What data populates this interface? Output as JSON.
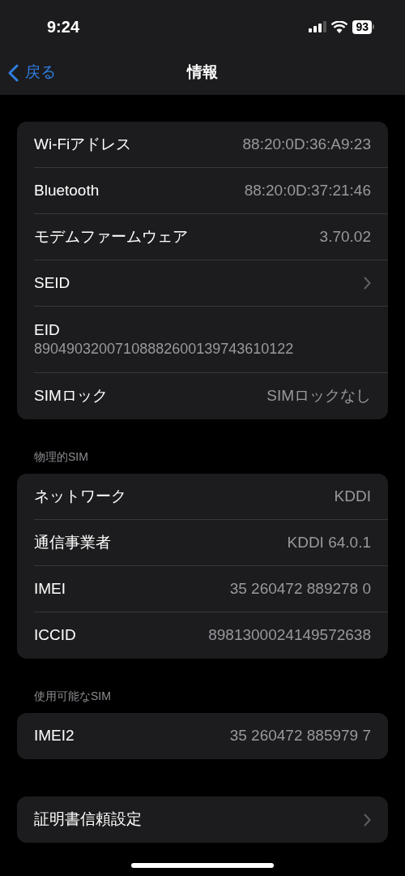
{
  "status_bar": {
    "time": "9:24",
    "battery": "93"
  },
  "nav": {
    "back": "戻る",
    "title": "情報"
  },
  "sections": [
    {
      "rows": [
        {
          "kind": "value",
          "label": "Wi-Fiアドレス",
          "value": "88:20:0D:36:A9:23"
        },
        {
          "kind": "value",
          "label": "Bluetooth",
          "value": "88:20:0D:37:21:46"
        },
        {
          "kind": "value",
          "label": "モデムファームウェア",
          "value": "3.70.02"
        },
        {
          "kind": "chevron",
          "label": "SEID"
        },
        {
          "kind": "stacked",
          "label": "EID",
          "value": "89049032007108882600139743610122"
        },
        {
          "kind": "value",
          "label": "SIMロック",
          "value": "SIMロックなし"
        }
      ]
    },
    {
      "header": "物理的SIM",
      "rows": [
        {
          "kind": "value",
          "label": "ネットワーク",
          "value": "KDDI"
        },
        {
          "kind": "value",
          "label": "通信事業者",
          "value": "KDDI 64.0.1"
        },
        {
          "kind": "value",
          "label": "IMEI",
          "value": "35 260472 889278 0"
        },
        {
          "kind": "value",
          "label": "ICCID",
          "value": "8981300024149572638"
        }
      ]
    },
    {
      "header": "使用可能なSIM",
      "rows": [
        {
          "kind": "value",
          "label": "IMEI2",
          "value": "35 260472 885979 7"
        }
      ]
    },
    {
      "rows": [
        {
          "kind": "chevron",
          "label": "証明書信頼設定"
        }
      ]
    }
  ]
}
